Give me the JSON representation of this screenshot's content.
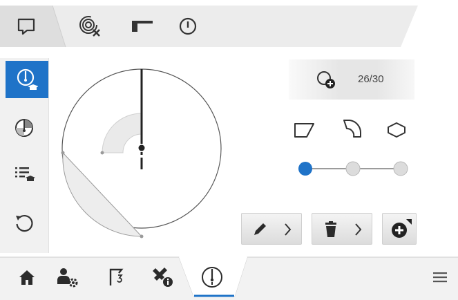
{
  "top_bar": {
    "icons": [
      "chat-icon",
      "target-cancel-icon",
      "edge-profile-icon",
      "power-icon"
    ]
  },
  "sidebar": {
    "items": [
      {
        "icon": "dial-cap-icon",
        "active": true
      },
      {
        "icon": "sector-fill-icon",
        "active": false
      },
      {
        "icon": "list-cap-icon",
        "active": false
      },
      {
        "icon": "reset-icon",
        "active": false
      }
    ]
  },
  "counter": {
    "icon": "add-circle-icon",
    "value": "26/30"
  },
  "shapes": [
    "trapezoid-shape-icon",
    "curved-shape-icon",
    "hexagon-shape-icon"
  ],
  "slider": {
    "positions": 3,
    "selected_index": 0
  },
  "actions": {
    "edit_icon": "pencil-icon",
    "delete_icon": "trash-icon",
    "add_icon": "plus-circle-icon"
  },
  "bottom_bar": {
    "icons": [
      "home-icon",
      "user-settings-icon",
      "flag-icon",
      "tools-info-icon",
      "dial-icon",
      "menu-icon"
    ],
    "active_index": 4
  },
  "colors": {
    "accent": "#1f73c8",
    "icon": "#2b2b2b",
    "panel": "#f1f1f1"
  }
}
